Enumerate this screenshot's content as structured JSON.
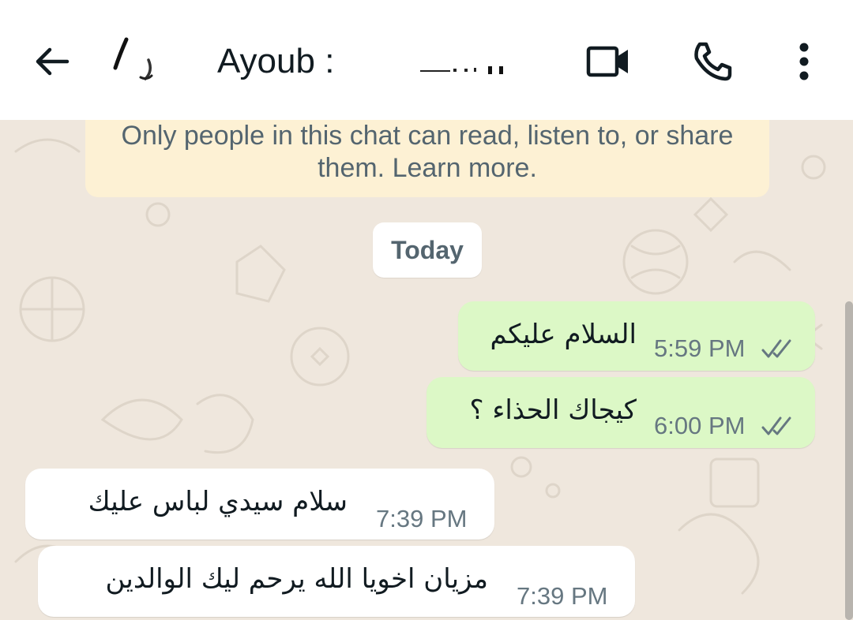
{
  "header": {
    "contact_name": "Ayoub :",
    "back_icon": "arrow-left-icon",
    "video_icon": "video-camera-icon",
    "call_icon": "phone-icon",
    "menu_icon": "more-vertical-icon"
  },
  "notice": {
    "line1": "Only people in this chat can read, listen to, or share",
    "line2": "them. Learn more."
  },
  "day_label": "Today",
  "messages": [
    {
      "direction": "outgoing",
      "text": "السلام عليكم",
      "time": "5:59 PM",
      "status": "read"
    },
    {
      "direction": "outgoing",
      "text": "كيجاك الحذاء ؟",
      "time": "6:00 PM",
      "status": "read"
    },
    {
      "direction": "incoming",
      "text": "سلام سيدي لباس عليك",
      "time": "7:39 PM"
    },
    {
      "direction": "incoming",
      "text": "مزيان اخويا الله يرحم ليك الوالدين",
      "time": "7:39 PM"
    }
  ],
  "colors": {
    "outgoing_bubble": "#dcf8c6",
    "incoming_bubble": "#ffffff",
    "notice_bg": "#fdf1d4",
    "chat_bg": "#efe7dd",
    "ticks": "#667781"
  }
}
